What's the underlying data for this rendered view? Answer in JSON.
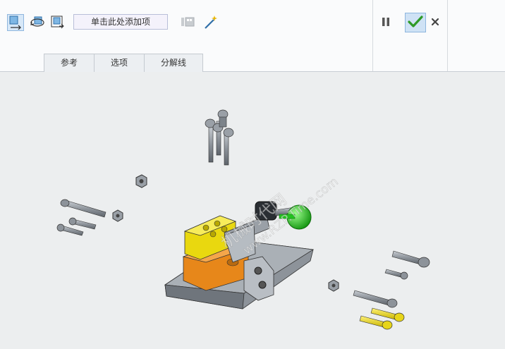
{
  "toolbar": {
    "add_item_label": "单击此处添加项",
    "icons": [
      "move-component-icon",
      "rotate-component-icon",
      "parallel-move-icon",
      "preview-icon",
      "magic-wand-icon"
    ]
  },
  "tabs": [
    {
      "label": "参考"
    },
    {
      "label": "选项"
    },
    {
      "label": "分解线"
    }
  ],
  "actions": {
    "pause_icon": "pause-icon",
    "ok_icon": "check-icon",
    "close_icon": "close-icon"
  },
  "watermark": {
    "line1": "机械时代网",
    "line2": "www.RZP.Time.com"
  },
  "colors": {
    "accent_check": "#2e9a28",
    "active_bg": "#d7e8f8",
    "part_gray": "#9ea4ab",
    "part_yellow": "#f2e21a",
    "part_orange": "#e7871a",
    "part_green": "#23c21f"
  }
}
